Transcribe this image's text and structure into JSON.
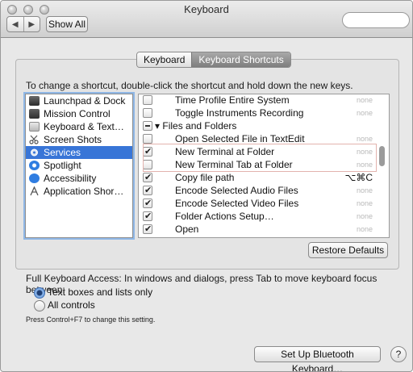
{
  "window": {
    "title": "Keyboard"
  },
  "toolbar": {
    "back_glyph": "◀",
    "forward_glyph": "▶",
    "show_all_label": "Show All"
  },
  "tabs": [
    {
      "label": "Keyboard",
      "active": false
    },
    {
      "label": "Keyboard Shortcuts",
      "active": true
    }
  ],
  "instruction": "To change a shortcut, double-click the shortcut and hold down the new keys.",
  "categories": [
    {
      "label": "Launchpad & Dock",
      "icon": "launchpad-icon",
      "selected": false
    },
    {
      "label": "Mission Control",
      "icon": "mission-control-icon",
      "selected": false
    },
    {
      "label": "Keyboard & Text…",
      "icon": "keyboard-icon",
      "selected": false
    },
    {
      "label": "Screen Shots",
      "icon": "scissors-icon",
      "selected": false
    },
    {
      "label": "Services",
      "icon": "gear-icon",
      "selected": true
    },
    {
      "label": "Spotlight",
      "icon": "spotlight-icon",
      "selected": false
    },
    {
      "label": "Accessibility",
      "icon": "accessibility-icon",
      "selected": false
    },
    {
      "label": "Application Shor…",
      "icon": "app-shortcut-icon",
      "selected": false
    }
  ],
  "shortcuts": [
    {
      "label": "Time Profile Entire System",
      "checked": false,
      "key": "none",
      "group": false
    },
    {
      "label": "Toggle Instruments Recording",
      "checked": false,
      "key": "none",
      "group": false
    },
    {
      "label": "Files and Folders",
      "checked": "partial",
      "key": "",
      "group": true
    },
    {
      "label": "Open Selected File in TextEdit",
      "checked": false,
      "key": "none",
      "group": false
    },
    {
      "label": "New Terminal at Folder",
      "checked": true,
      "key": "none",
      "group": false
    },
    {
      "label": "New Terminal Tab at Folder",
      "checked": false,
      "key": "none",
      "group": false
    },
    {
      "label": "Copy file path",
      "checked": true,
      "key": "⌥⌘C",
      "group": false
    },
    {
      "label": "Encode Selected Audio Files",
      "checked": true,
      "key": "none",
      "group": false
    },
    {
      "label": "Encode Selected Video Files",
      "checked": true,
      "key": "none",
      "group": false
    },
    {
      "label": "Folder Actions Setup…",
      "checked": true,
      "key": "none",
      "group": false
    },
    {
      "label": "Open",
      "checked": true,
      "key": "none",
      "group": false
    }
  ],
  "restore_label": "Restore Defaults",
  "full_access": {
    "label": "Full Keyboard Access: In windows and dialogs, press Tab to move keyboard focus between:",
    "options": [
      {
        "label": "Text boxes and lists only",
        "selected": true
      },
      {
        "label": "All controls",
        "selected": false
      }
    ],
    "hint": "Press Control+F7 to change this setting."
  },
  "bluetooth_label": "Set Up Bluetooth Keyboard…",
  "help_label": "?"
}
